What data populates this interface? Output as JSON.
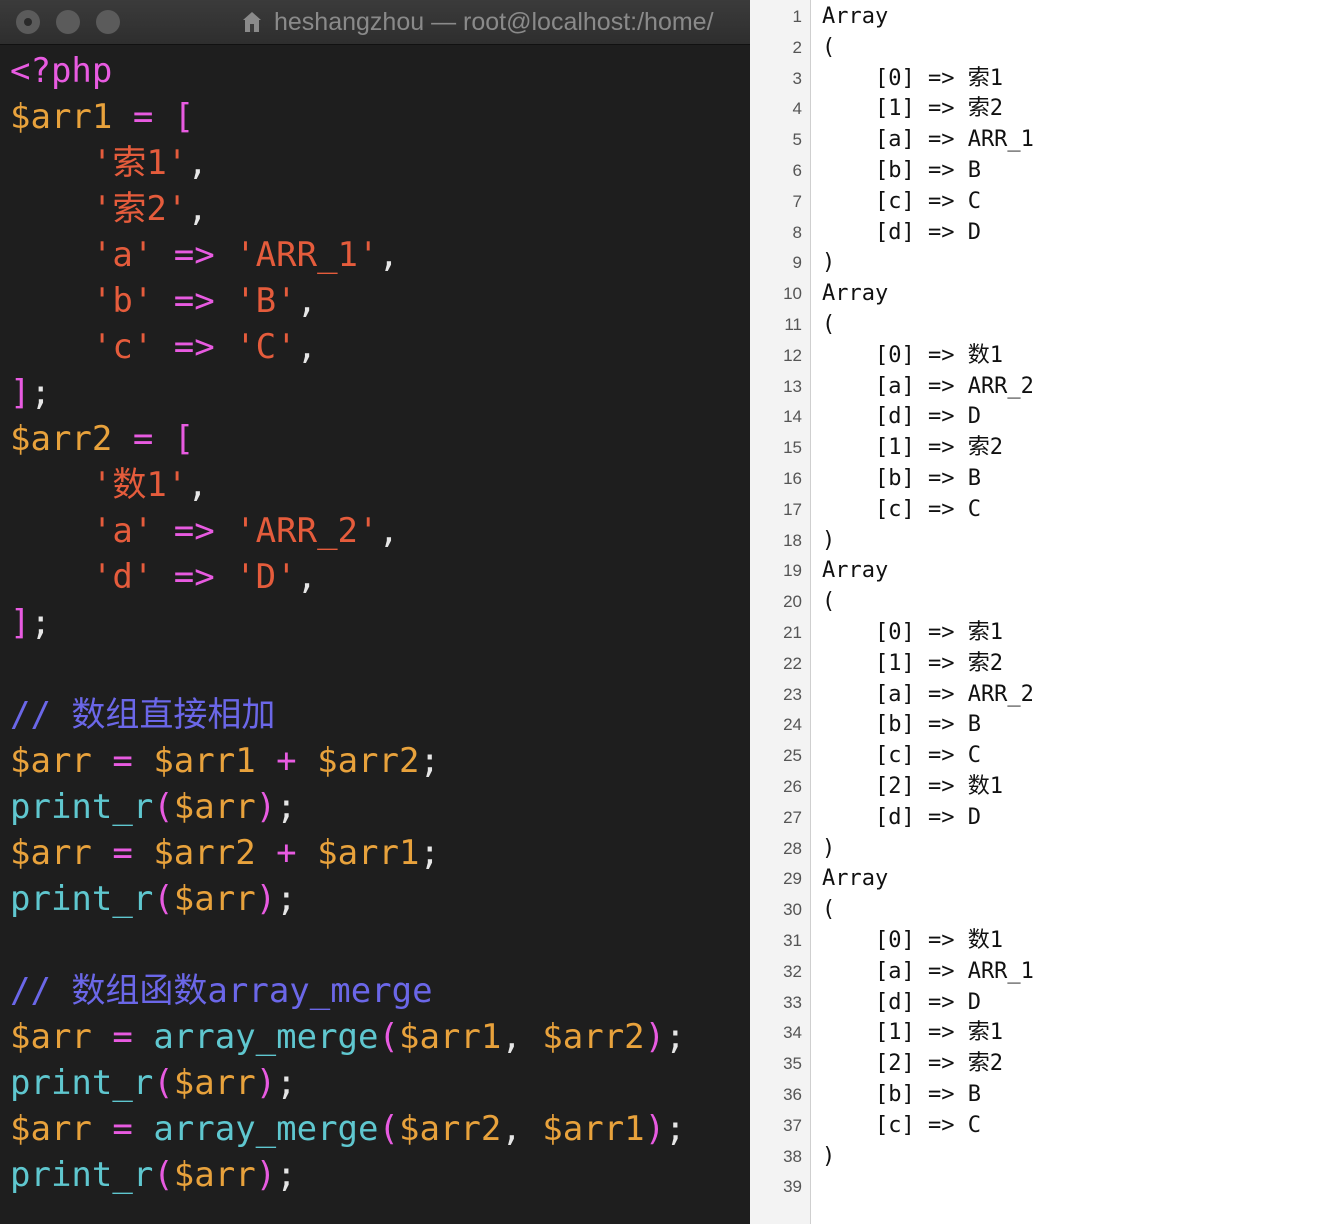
{
  "window": {
    "title": "heshangzhou — root@localhost:/home/"
  },
  "code": {
    "lines": [
      [
        {
          "t": "<?php",
          "c": "kw"
        }
      ],
      [
        {
          "t": "$arr1",
          "c": "var"
        },
        {
          "t": " = ",
          "c": "op"
        },
        {
          "t": "[",
          "c": "brk"
        }
      ],
      [
        {
          "t": "    ",
          "c": "pn"
        },
        {
          "t": "'索1'",
          "c": "str"
        },
        {
          "t": ",",
          "c": "pn"
        }
      ],
      [
        {
          "t": "    ",
          "c": "pn"
        },
        {
          "t": "'索2'",
          "c": "str"
        },
        {
          "t": ",",
          "c": "pn"
        }
      ],
      [
        {
          "t": "    ",
          "c": "pn"
        },
        {
          "t": "'a'",
          "c": "str"
        },
        {
          "t": " => ",
          "c": "op"
        },
        {
          "t": "'ARR_1'",
          "c": "str"
        },
        {
          "t": ",",
          "c": "pn"
        }
      ],
      [
        {
          "t": "    ",
          "c": "pn"
        },
        {
          "t": "'b'",
          "c": "str"
        },
        {
          "t": " => ",
          "c": "op"
        },
        {
          "t": "'B'",
          "c": "str"
        },
        {
          "t": ",",
          "c": "pn"
        }
      ],
      [
        {
          "t": "    ",
          "c": "pn"
        },
        {
          "t": "'c'",
          "c": "str"
        },
        {
          "t": " => ",
          "c": "op"
        },
        {
          "t": "'C'",
          "c": "str"
        },
        {
          "t": ",",
          "c": "pn"
        }
      ],
      [
        {
          "t": "]",
          "c": "brk"
        },
        {
          "t": ";",
          "c": "pn"
        }
      ],
      [
        {
          "t": "$arr2",
          "c": "var"
        },
        {
          "t": " = ",
          "c": "op"
        },
        {
          "t": "[",
          "c": "brk"
        }
      ],
      [
        {
          "t": "    ",
          "c": "pn"
        },
        {
          "t": "'数1'",
          "c": "str"
        },
        {
          "t": ",",
          "c": "pn"
        }
      ],
      [
        {
          "t": "    ",
          "c": "pn"
        },
        {
          "t": "'a'",
          "c": "str"
        },
        {
          "t": " => ",
          "c": "op"
        },
        {
          "t": "'ARR_2'",
          "c": "str"
        },
        {
          "t": ",",
          "c": "pn"
        }
      ],
      [
        {
          "t": "    ",
          "c": "pn"
        },
        {
          "t": "'d'",
          "c": "str"
        },
        {
          "t": " => ",
          "c": "op"
        },
        {
          "t": "'D'",
          "c": "str"
        },
        {
          "t": ",",
          "c": "pn"
        }
      ],
      [
        {
          "t": "]",
          "c": "brk"
        },
        {
          "t": ";",
          "c": "pn"
        }
      ],
      [],
      [
        {
          "t": "// 数组直接相加",
          "c": "cm"
        }
      ],
      [
        {
          "t": "$arr",
          "c": "var"
        },
        {
          "t": " = ",
          "c": "op"
        },
        {
          "t": "$arr1",
          "c": "var"
        },
        {
          "t": " + ",
          "c": "op"
        },
        {
          "t": "$arr2",
          "c": "var"
        },
        {
          "t": ";",
          "c": "pn"
        }
      ],
      [
        {
          "t": "print_r",
          "c": "fn"
        },
        {
          "t": "(",
          "c": "brk"
        },
        {
          "t": "$arr",
          "c": "var"
        },
        {
          "t": ")",
          "c": "brk"
        },
        {
          "t": ";",
          "c": "pn"
        }
      ],
      [
        {
          "t": "$arr",
          "c": "var"
        },
        {
          "t": " = ",
          "c": "op"
        },
        {
          "t": "$arr2",
          "c": "var"
        },
        {
          "t": " + ",
          "c": "op"
        },
        {
          "t": "$arr1",
          "c": "var"
        },
        {
          "t": ";",
          "c": "pn"
        }
      ],
      [
        {
          "t": "print_r",
          "c": "fn"
        },
        {
          "t": "(",
          "c": "brk"
        },
        {
          "t": "$arr",
          "c": "var"
        },
        {
          "t": ")",
          "c": "brk"
        },
        {
          "t": ";",
          "c": "pn"
        }
      ],
      [],
      [
        {
          "t": "// 数组函数array_merge",
          "c": "cm"
        }
      ],
      [
        {
          "t": "$arr",
          "c": "var"
        },
        {
          "t": " = ",
          "c": "op"
        },
        {
          "t": "array_merge",
          "c": "fn"
        },
        {
          "t": "(",
          "c": "brk"
        },
        {
          "t": "$arr1",
          "c": "var"
        },
        {
          "t": ", ",
          "c": "pn"
        },
        {
          "t": "$arr2",
          "c": "var"
        },
        {
          "t": ")",
          "c": "brk"
        },
        {
          "t": ";",
          "c": "pn"
        }
      ],
      [
        {
          "t": "print_r",
          "c": "fn"
        },
        {
          "t": "(",
          "c": "brk"
        },
        {
          "t": "$arr",
          "c": "var"
        },
        {
          "t": ")",
          "c": "brk"
        },
        {
          "t": ";",
          "c": "pn"
        }
      ],
      [
        {
          "t": "$arr",
          "c": "var"
        },
        {
          "t": " = ",
          "c": "op"
        },
        {
          "t": "array_merge",
          "c": "fn"
        },
        {
          "t": "(",
          "c": "brk"
        },
        {
          "t": "$arr2",
          "c": "var"
        },
        {
          "t": ", ",
          "c": "pn"
        },
        {
          "t": "$arr1",
          "c": "var"
        },
        {
          "t": ")",
          "c": "brk"
        },
        {
          "t": ";",
          "c": "pn"
        }
      ],
      [
        {
          "t": "print_r",
          "c": "fn"
        },
        {
          "t": "(",
          "c": "brk"
        },
        {
          "t": "$arr",
          "c": "var"
        },
        {
          "t": ")",
          "c": "brk"
        },
        {
          "t": ";",
          "c": "pn"
        }
      ]
    ]
  },
  "output": {
    "lines": [
      {
        "n": "1",
        "text": "Array"
      },
      {
        "n": "2",
        "text": "("
      },
      {
        "n": "3",
        "text": "    [0] => 索1"
      },
      {
        "n": "4",
        "text": "    [1] => 索2"
      },
      {
        "n": "5",
        "text": "    [a] => ARR_1"
      },
      {
        "n": "6",
        "text": "    [b] => B"
      },
      {
        "n": "7",
        "text": "    [c] => C"
      },
      {
        "n": "8",
        "text": "    [d] => D"
      },
      {
        "n": "9",
        "text": ")"
      },
      {
        "n": "10",
        "text": "Array"
      },
      {
        "n": "11",
        "text": "("
      },
      {
        "n": "12",
        "text": "    [0] => 数1"
      },
      {
        "n": "13",
        "text": "    [a] => ARR_2"
      },
      {
        "n": "14",
        "text": "    [d] => D"
      },
      {
        "n": "15",
        "text": "    [1] => 索2"
      },
      {
        "n": "16",
        "text": "    [b] => B"
      },
      {
        "n": "17",
        "text": "    [c] => C"
      },
      {
        "n": "18",
        "text": ")"
      },
      {
        "n": "19",
        "text": "Array"
      },
      {
        "n": "20",
        "text": "("
      },
      {
        "n": "21",
        "text": "    [0] => 索1"
      },
      {
        "n": "22",
        "text": "    [1] => 索2"
      },
      {
        "n": "23",
        "text": "    [a] => ARR_2"
      },
      {
        "n": "24",
        "text": "    [b] => B"
      },
      {
        "n": "25",
        "text": "    [c] => C"
      },
      {
        "n": "26",
        "text": "    [2] => 数1"
      },
      {
        "n": "27",
        "text": "    [d] => D"
      },
      {
        "n": "28",
        "text": ")"
      },
      {
        "n": "29",
        "text": "Array"
      },
      {
        "n": "30",
        "text": "("
      },
      {
        "n": "31",
        "text": "    [0] => 数1"
      },
      {
        "n": "32",
        "text": "    [a] => ARR_1"
      },
      {
        "n": "33",
        "text": "    [d] => D"
      },
      {
        "n": "34",
        "text": "    [1] => 索1"
      },
      {
        "n": "35",
        "text": "    [2] => 索2"
      },
      {
        "n": "36",
        "text": "    [b] => B"
      },
      {
        "n": "37",
        "text": "    [c] => C"
      },
      {
        "n": "38",
        "text": ")"
      },
      {
        "n": "39",
        "text": ""
      }
    ]
  },
  "colors": {
    "terminal_bg": "#1e1e1e",
    "keyword": "#e85be1",
    "variable": "#e8a23c",
    "string": "#e55c3c",
    "comment": "#6b67e8",
    "function": "#5fc7cf"
  },
  "icons": {
    "title_icon": "house-icon"
  }
}
